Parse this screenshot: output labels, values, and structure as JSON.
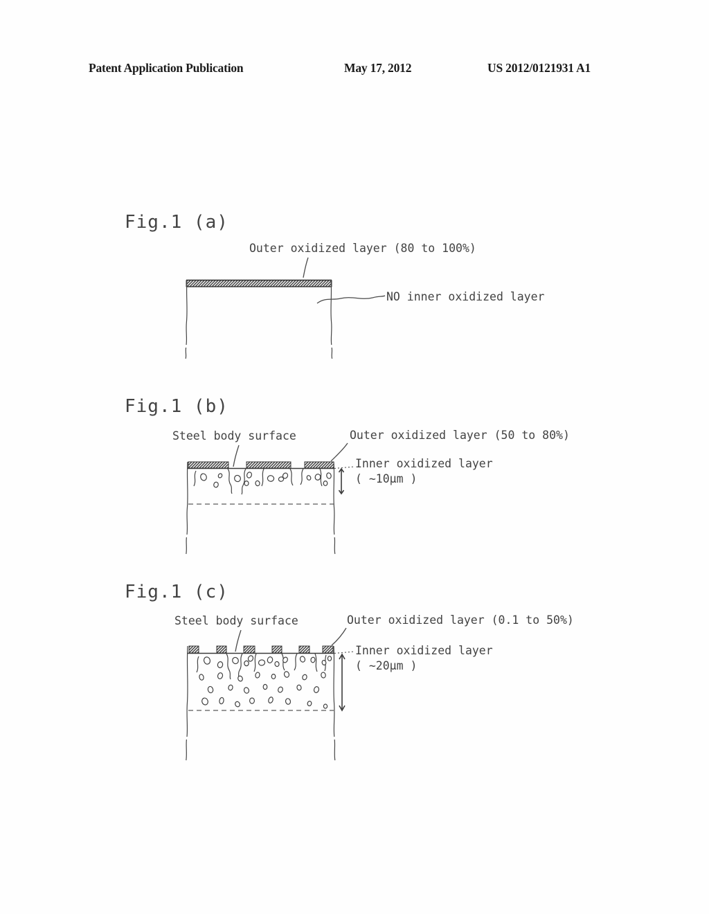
{
  "header": {
    "left": "Patent Application Publication",
    "date": "May 17, 2012",
    "pubnum": "US 2012/0121931 A1"
  },
  "figures": [
    {
      "id": "fig-1a",
      "caption": "Fig.1 (a)",
      "labels": {
        "outer": "Outer oxidized layer (80 to 100%)",
        "inner": "NO inner oxidized layer"
      }
    },
    {
      "id": "fig-1b",
      "caption": "Fig.1 (b)",
      "labels": {
        "surface": "Steel body surface",
        "outer": "Outer oxidized layer (50 to 80%)",
        "inner_line1": "Inner oxidized layer",
        "inner_line2": "( ~10μm )"
      }
    },
    {
      "id": "fig-1c",
      "caption": "Fig.1 (c)",
      "labels": {
        "surface": "Steel body surface",
        "outer": "Outer oxidized layer (0.1 to 50%)",
        "inner_line1": "Inner oxidized layer",
        "inner_line2": "( ~20μm )"
      }
    }
  ],
  "colors": {
    "ink": "#3a3a3a",
    "paper": "#fefefe",
    "hatch": "#4a4a4a"
  }
}
